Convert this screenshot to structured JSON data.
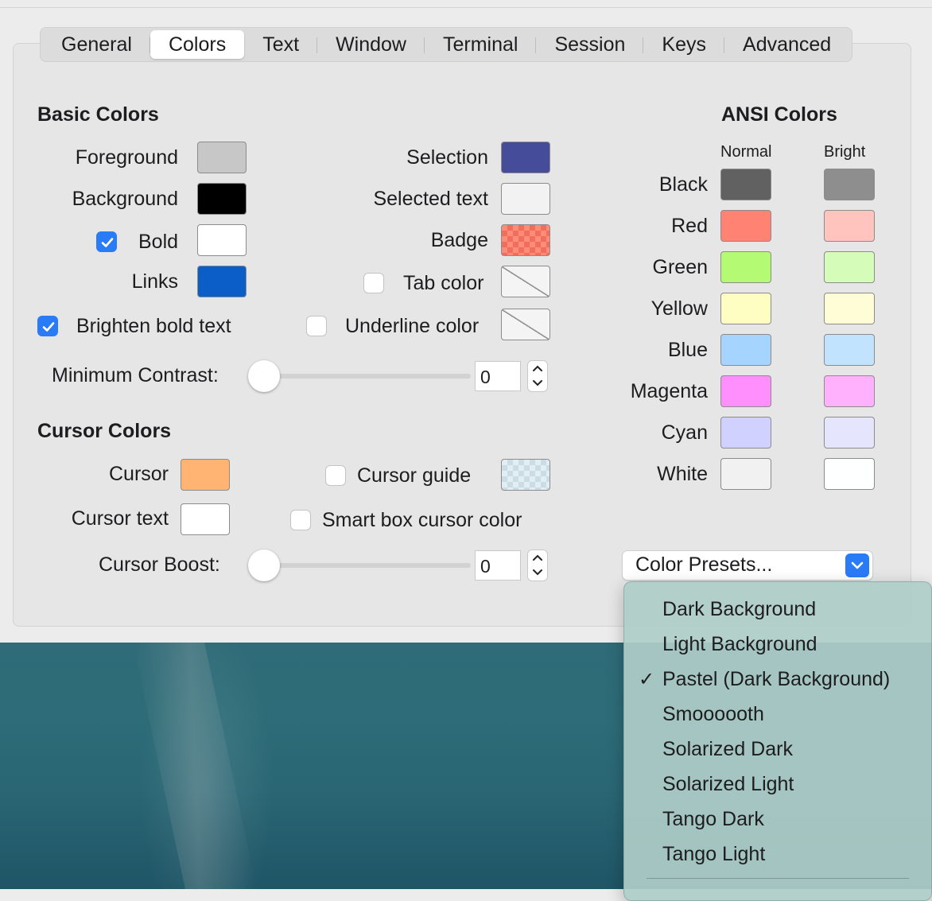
{
  "tabs": [
    "General",
    "Colors",
    "Text",
    "Window",
    "Terminal",
    "Session",
    "Keys",
    "Advanced"
  ],
  "active_tab": "Colors",
  "basic": {
    "title": "Basic Colors",
    "foreground": "Foreground",
    "background": "Background",
    "bold": "Bold",
    "links": "Links",
    "brighten_bold": "Brighten bold text",
    "selection": "Selection",
    "selected_text": "Selected text",
    "badge": "Badge",
    "tab_color": "Tab color",
    "underline_color": "Underline color",
    "min_contrast": "Minimum Contrast:",
    "min_contrast_value": "0",
    "colors": {
      "foreground": "#c7c7c7",
      "background": "#000000",
      "bold": "#ffffff",
      "links": "#0b5ec8",
      "selection": "#454c99",
      "selected_text": "#f2f2f2"
    }
  },
  "cursor": {
    "title": "Cursor Colors",
    "cursor": "Cursor",
    "cursor_text": "Cursor text",
    "cursor_guide": "Cursor guide",
    "smart_box": "Smart box cursor color",
    "boost": "Cursor Boost:",
    "boost_value": "0",
    "colors": {
      "cursor": "#ffb473",
      "cursor_text": "#ffffff"
    }
  },
  "ansi": {
    "title": "ANSI Colors",
    "normal": "Normal",
    "bright": "Bright",
    "rows": [
      {
        "name": "Black",
        "normal": "#616161",
        "bright": "#8e8e8e"
      },
      {
        "name": "Red",
        "normal": "#ff8272",
        "bright": "#ffc4bd"
      },
      {
        "name": "Green",
        "normal": "#b4fa72",
        "bright": "#d6fcb9"
      },
      {
        "name": "Yellow",
        "normal": "#fefdc2",
        "bright": "#fefdd5"
      },
      {
        "name": "Blue",
        "normal": "#a5d5fe",
        "bright": "#c1e3fe"
      },
      {
        "name": "Magenta",
        "normal": "#ff8ffd",
        "bright": "#ffb1fe"
      },
      {
        "name": "Cyan",
        "normal": "#d0d1fe",
        "bright": "#e5e6fe"
      },
      {
        "name": "White",
        "normal": "#f1f1f1",
        "bright": "#feffff"
      }
    ]
  },
  "presets": {
    "label": "Color Presets...",
    "checkmark": "✓",
    "items": [
      {
        "label": "Dark Background",
        "checked": false
      },
      {
        "label": "Light Background",
        "checked": false
      },
      {
        "label": "Pastel (Dark Background)",
        "checked": true
      },
      {
        "label": "Smoooooth",
        "checked": false
      },
      {
        "label": "Solarized Dark",
        "checked": false
      },
      {
        "label": "Solarized Light",
        "checked": false
      },
      {
        "label": "Tango Dark",
        "checked": false
      },
      {
        "label": "Tango Light",
        "checked": false
      }
    ]
  }
}
